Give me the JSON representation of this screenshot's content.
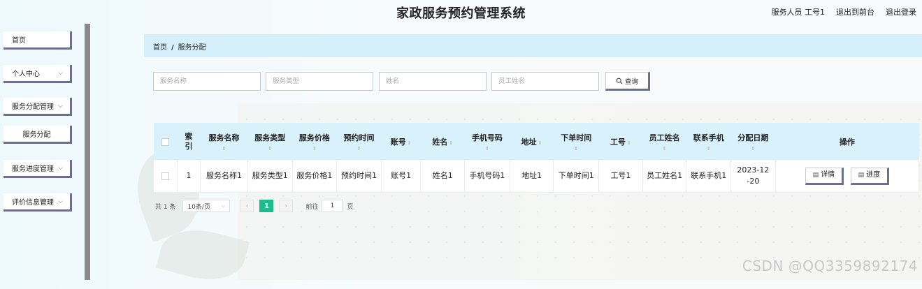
{
  "header": {
    "title": "家政服务预约管理系统",
    "user_label": "服务人员 工号1",
    "front_link": "退出到前台",
    "logout_link": "退出登录"
  },
  "sidebar": {
    "items": [
      {
        "label": "首页"
      },
      {
        "label": "个人中心"
      },
      {
        "label": "服务分配管理"
      },
      {
        "label": "服务分配"
      },
      {
        "label": "服务进度管理"
      },
      {
        "label": "评价信息管理"
      }
    ],
    "chevron_icon": "chevron-down-icon"
  },
  "breadcrumb": {
    "home": "首页",
    "separator": "/",
    "current": "服务分配"
  },
  "search": {
    "service_name_placeholder": "服务名称",
    "service_type_placeholder": "服务类型",
    "name_placeholder": "姓名",
    "employee_name_placeholder": "员工姓名",
    "query_label": "查询",
    "query_icon": "search-icon"
  },
  "table": {
    "columns": {
      "index": "索引",
      "service_name": "服务名称",
      "service_type": "服务类型",
      "service_price": "服务价格",
      "appointment_time": "预约时间",
      "account": "账号",
      "name": "姓名",
      "phone": "手机号码",
      "address": "地址",
      "order_time": "下单时间",
      "employee_id": "工号",
      "employee_name": "员工姓名",
      "contact_phone": "联系手机",
      "assign_date": "分配日期",
      "actions": "操作"
    },
    "rows": [
      {
        "index": "1",
        "service_name": "服务名称1",
        "service_type": "服务类型1",
        "service_price": "服务价格1",
        "appointment_time": "预约时间1",
        "account": "账号1",
        "name": "姓名1",
        "phone": "手机号码1",
        "address": "地址1",
        "order_time": "下单时间1",
        "employee_id": "工号1",
        "employee_name": "员工姓名1",
        "contact_phone": "联系手机1",
        "assign_date": "2023-12-20",
        "detail_label": "详情",
        "progress_label": "进度"
      }
    ]
  },
  "pagination": {
    "total": "共 1 条",
    "page_size": "10条/页",
    "prev": "‹",
    "current_page": "1",
    "next": "›",
    "goto_prefix": "前往",
    "goto_value": "1",
    "goto_suffix": "页"
  },
  "watermark": "CSDN @QQ3359892174"
}
